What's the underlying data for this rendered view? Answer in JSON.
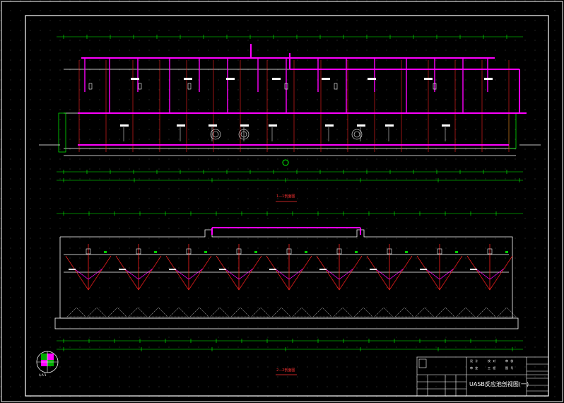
{
  "drawing": {
    "title": "UASB反应池剖视图(一)",
    "section_1_label": "1—1剖面图",
    "section_2_label": "2—2剖面图",
    "compass_label": "A-A'1",
    "colors": {
      "background": "#000000",
      "frame": "#ffffff",
      "structure": "#ffffff",
      "pipe_main": "#ff00ff",
      "pipe_red": "#ff2020",
      "dimension": "#00ff00",
      "accent_green": "#00cc00",
      "text_yellow": "#ffff00"
    }
  },
  "title_block": {
    "title": "UASB反应池剖视图(一)",
    "cells": [
      "设 计",
      "校 对",
      "审 核",
      "审 定",
      "工 程",
      "图 号"
    ]
  }
}
